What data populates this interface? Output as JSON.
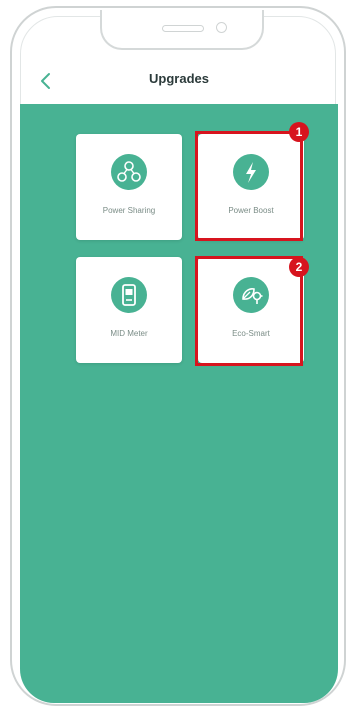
{
  "header": {
    "title": "Upgrades",
    "back_icon": "chevron-left-icon"
  },
  "tiles": [
    {
      "label": "Power Sharing",
      "icon": "network-icon"
    },
    {
      "label": "Power Boost",
      "icon": "lightning-icon"
    },
    {
      "label": "MID Meter",
      "icon": "meter-icon"
    },
    {
      "label": "Eco-Smart",
      "icon": "eco-plug-icon"
    }
  ],
  "callouts": [
    {
      "number": "1"
    },
    {
      "number": "2"
    }
  ],
  "colors": {
    "accent": "#48b293",
    "highlight": "#d7141e",
    "title": "#2b3a3a"
  }
}
